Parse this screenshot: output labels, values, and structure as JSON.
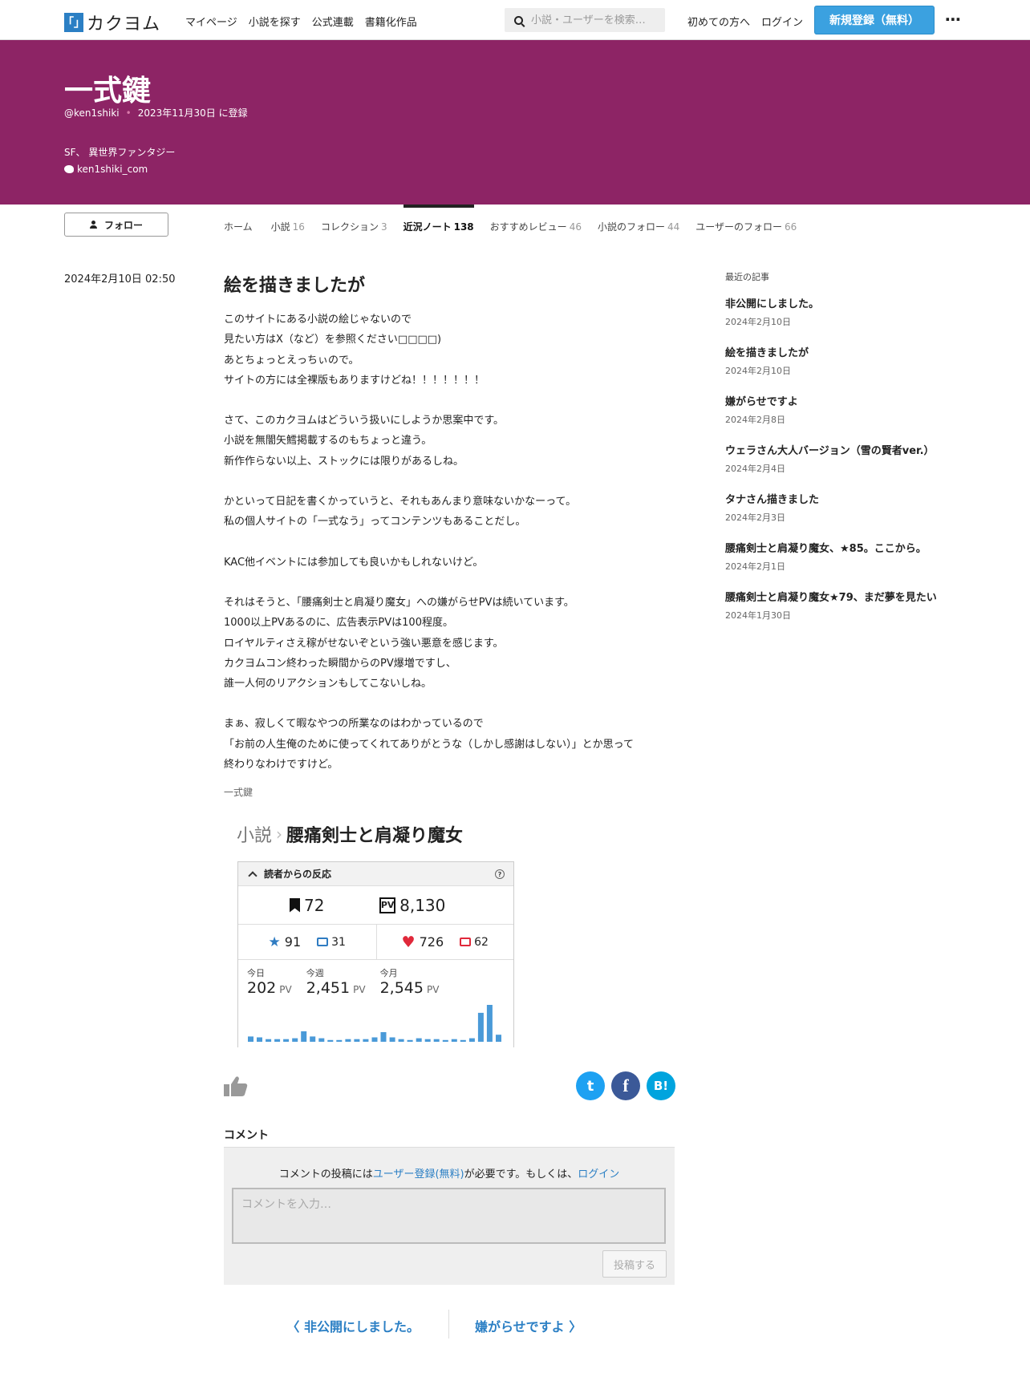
{
  "header": {
    "logo_mark": "「」",
    "logo_text": "カクヨム",
    "nav": [
      "マイページ",
      "小説を探す",
      "公式連載",
      "書籍化作品"
    ],
    "search_placeholder": "小説・ユーザーを検索…",
    "beginner": "初めての方へ",
    "login": "ログイン",
    "signup": "新規登録（無料）",
    "more": "⋯"
  },
  "profile": {
    "name": "一式鍵",
    "handle": "@ken1shiki",
    "registered": "2023年11月30日 に登録",
    "genres": "SF、 異世界ファンタジー",
    "twitter": "ken1shiki_com",
    "banner_color": "#8d2465"
  },
  "follow_label": "フォロー",
  "tabs": [
    {
      "label": "ホーム",
      "count": ""
    },
    {
      "label": "小説",
      "count": "16"
    },
    {
      "label": "コレクション",
      "count": "3"
    },
    {
      "label": "近況ノート",
      "count": "138",
      "active": true
    },
    {
      "label": "おすすめレビュー",
      "count": "46"
    },
    {
      "label": "小説のフォロー",
      "count": "44"
    },
    {
      "label": "ユーザーのフォロー",
      "count": "66"
    }
  ],
  "post": {
    "date": "2024年2月10日 02:50",
    "title": "絵を描きましたが",
    "lines": [
      "このサイトにある小説の絵じゃないので",
      "見たい方はX（など）を参照ください□□□□)",
      "あとちょっとえっちぃので。",
      "サイトの方には全裸版もありますけどね！！！！！！！",
      "",
      "さて、このカクヨムはどういう扱いにしようか思案中です。",
      "小説を無闇矢鱈掲載するのもちょっと違う。",
      "新作作らない以上、ストックには限りがあるしね。",
      "",
      "かといって日記を書くかっていうと、それもあんまり意味ないかなーって。",
      "私の個人サイトの「一式なう」ってコンテンツもあることだし。",
      "",
      "KAC他イベントには参加しても良いかもしれないけど。",
      "",
      "それはそうと、「腰痛剣士と肩凝り魔女」への嫌がらせPVは続いています。",
      "1000以上PVあるのに、広告表示PVは100程度。",
      "ロイヤルティさえ稼がせないぞという強い悪意を感じます。",
      "カクヨムコン終わった瞬間からのPV爆増ですし、",
      "誰一人何のリアクションもしてこないしね。",
      "",
      "まぁ、寂しくて暇なやつの所業なのはわかっているので",
      "「お前の人生俺のために使ってくれてありがとうな（しかし感謝はしない）」とか思って",
      "終わりなわけですけど。"
    ],
    "author": "一式鍵"
  },
  "embed": {
    "crumb_section": "小説",
    "crumb_chevron": "›",
    "crumb_title": "腰痛剣士と肩凝り魔女",
    "stats_heading": "読者からの反応",
    "help": "?",
    "bookmarks": "72",
    "pv_badge": "PV",
    "pv_total": "8,130",
    "star_glyph": "★",
    "stars": "91",
    "star_comments": "31",
    "heart_glyph": "♥",
    "hearts": "726",
    "heart_comments": "62",
    "today_label": "今日",
    "today_value": "202",
    "week_label": "今週",
    "week_value": "2,451",
    "month_label": "今月",
    "month_value": "2,545",
    "pv_unit": "PV",
    "bar_color": "#4a9ad8",
    "daily_bars": [
      6,
      5,
      3,
      3,
      3,
      4,
      12,
      6,
      4,
      2,
      2,
      3,
      3,
      3,
      5,
      11,
      5,
      3,
      2,
      4,
      3,
      3,
      2,
      3,
      2,
      4,
      33,
      42,
      8
    ]
  },
  "share": {
    "twitter": "t",
    "facebook": "f",
    "hatena": "B!"
  },
  "comments": {
    "title": "コメント",
    "note_before": "コメントの投稿には",
    "note_link1": "ユーザー登録(無料)",
    "note_middle": "が必要です。もしくは、",
    "note_link2": "ログイン",
    "placeholder": "コメントを入力…",
    "submit": "投稿する"
  },
  "pager": {
    "prev": "〈 非公開にしました。",
    "next": "嫌がらせですよ 〉"
  },
  "sidebar": {
    "heading": "最近の記事",
    "items": [
      {
        "title": "非公開にしました。",
        "date": "2024年2月10日"
      },
      {
        "title": "絵を描きましたが",
        "date": "2024年2月10日"
      },
      {
        "title": "嫌がらせですよ",
        "date": "2024年2月8日"
      },
      {
        "title": "ウェラさん大人バージョン（雪の賢者ver.）",
        "date": "2024年2月4日"
      },
      {
        "title": "タナさん描きました",
        "date": "2024年2月3日"
      },
      {
        "title": "腰痛剣士と肩凝り魔女、★85。ここから。",
        "date": "2024年2月1日"
      },
      {
        "title": "腰痛剣士と肩凝り魔女★79、まだ夢を見たい",
        "date": "2024年1月30日"
      }
    ]
  }
}
